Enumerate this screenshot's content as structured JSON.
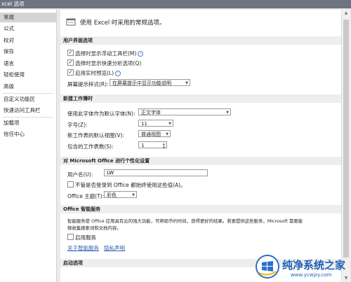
{
  "window": {
    "title": "xcel 选项"
  },
  "sidebar": {
    "items": [
      {
        "label": "常规",
        "selected": true
      },
      {
        "label": "公式"
      },
      {
        "label": "校对"
      },
      {
        "label": "保存"
      },
      {
        "label": "语言"
      },
      {
        "label": "轻松使用"
      },
      {
        "label": "高级"
      },
      {
        "label": "自定义功能区"
      },
      {
        "label": "快速访问工具栏"
      },
      {
        "label": "加载项"
      },
      {
        "label": "信任中心"
      }
    ]
  },
  "main": {
    "intro": "使用 Excel 时采用的常规选项。",
    "ui_options": {
      "header": "用户界面选项",
      "floating_toolbar": {
        "label": "选择时显示浮动工具栏(M)",
        "checked": true
      },
      "quick_analysis": {
        "label": "选择时显示快速分析选项(Q)",
        "checked": true
      },
      "live_preview": {
        "label": "启用实时预览(L)",
        "checked": true
      },
      "screentip_label": "屏幕提示样式(R):",
      "screentip_value": "在屏幕提示中显示功能说明"
    },
    "new_workbook": {
      "header": "新建工作簿时",
      "font_label": "使用此字体作为默认字体(N):",
      "font_value": "正文字体",
      "size_label": "字号(Z):",
      "size_value": "11",
      "view_label": "新工作表的默认视图(V):",
      "view_value": "普通视图",
      "sheets_label": "包含的工作表数(S):",
      "sheets_value": "1"
    },
    "personalize": {
      "header": "对 Microsoft Office 进行个性化设置",
      "username_label": "用户名(U):",
      "username_value": "LW",
      "always_use_label": "不管是否登录到 Office 都始终使用这些值(A)。",
      "always_use_checked": false,
      "theme_label": "Office 主题(T):",
      "theme_value": "彩色"
    },
    "intelligent": {
      "header": "Office 智能服务",
      "desc_line1": "智能服务使 Office 应用具有云的强大功能，可帮助节约时间，获得更好的结果。若要提供这些服务，Microsoft 需要能",
      "desc_line2": "够收集搜索词和文档内容。",
      "enable_label": "启用服务",
      "enable_checked": false,
      "link_about": "关于智能服务",
      "link_privacy": "隐私声明"
    },
    "startup": {
      "header": "启动选项"
    }
  },
  "watermark": {
    "name": "纯净系统之家",
    "url": "www.ycwjzy.com"
  }
}
